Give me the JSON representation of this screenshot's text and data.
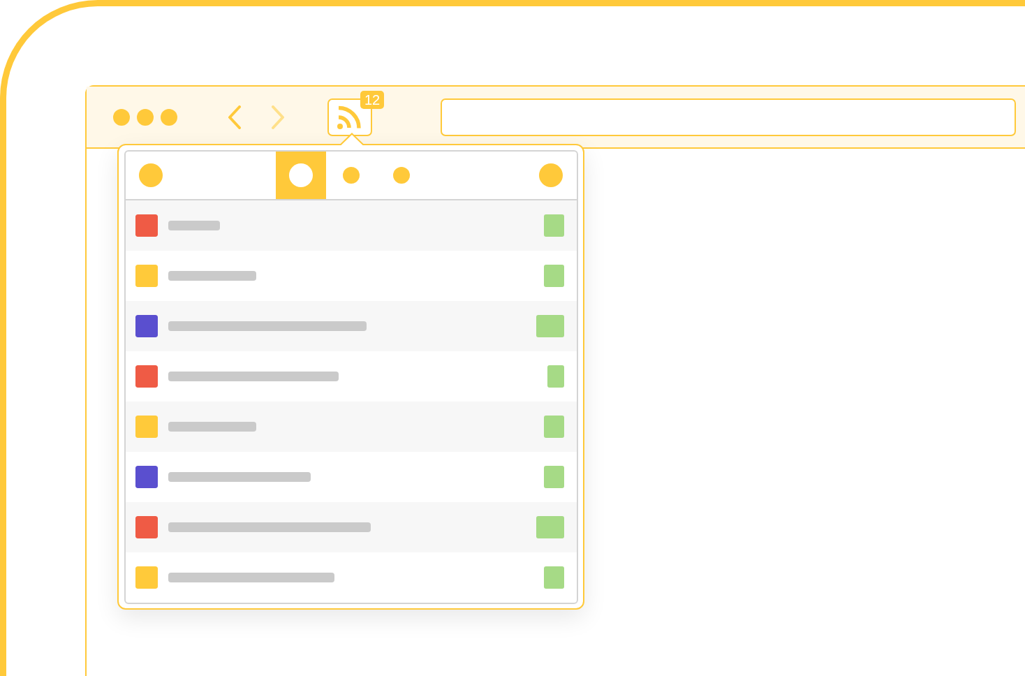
{
  "toolbar": {
    "back": {
      "disabled": false
    },
    "forward": {
      "disabled": true
    },
    "feed_button": {
      "badge": "12"
    }
  },
  "popup": {
    "tabs": [
      {
        "selected": true
      },
      {
        "selected": false
      },
      {
        "selected": false
      }
    ],
    "items": [
      {
        "color": "#ef5b45"
      },
      {
        "color": "#ffca3a"
      },
      {
        "color": "#5a4fcf"
      },
      {
        "color": "#ef5b45"
      },
      {
        "color": "#ffca3a"
      },
      {
        "color": "#5a4fcf"
      },
      {
        "color": "#ef5b45"
      },
      {
        "color": "#ffca3a"
      }
    ]
  }
}
